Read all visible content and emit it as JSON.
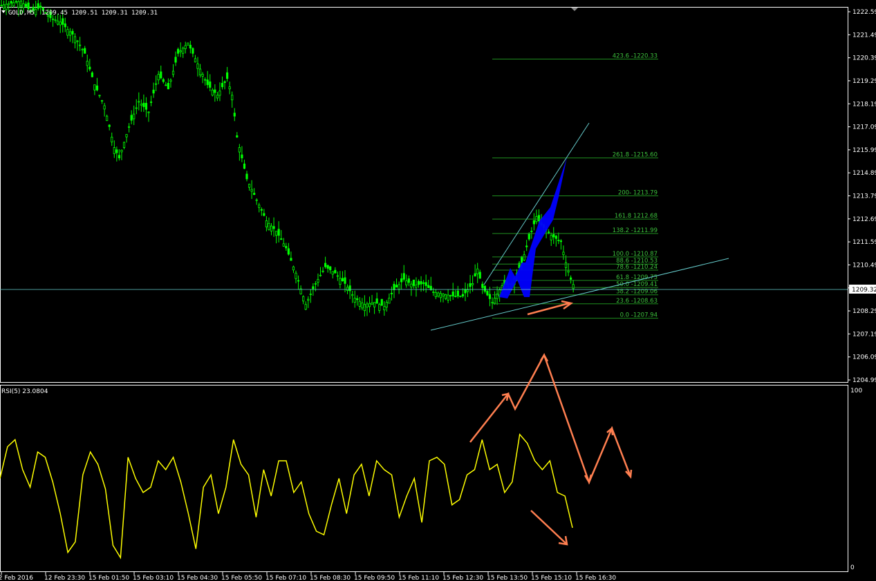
{
  "header": {
    "symbol_timeframe": "GOLD,M5",
    "ohlc": "1209.45 1209.51 1209.31 1209.31"
  },
  "price_axis": {
    "ticks": [
      "1222.59",
      "1221.49",
      "1220.39",
      "1219.29",
      "1218.19",
      "1217.09",
      "1215.99",
      "1214.89",
      "1213.79",
      "1212.69",
      "1211.59",
      "1210.49",
      "1209.39",
      "1208.29",
      "1207.19",
      "1206.09",
      "1204.99"
    ],
    "current_price_label": "1209.32"
  },
  "rsi": {
    "label": "RSI(5) 23.0804",
    "scale_max": "100",
    "scale_min": "0"
  },
  "time_axis": {
    "ticks": [
      "12 Feb 2016",
      "12 Feb 23:30",
      "15 Feb 01:50",
      "15 Feb 03:10",
      "15 Feb 04:30",
      "15 Feb 05:50",
      "15 Feb 07:10",
      "15 Feb 08:30",
      "15 Feb 09:50",
      "15 Feb 11:10",
      "15 Feb 12:30",
      "15 Feb 13:50",
      "15 Feb 15:10",
      "15 Feb 16:30"
    ]
  },
  "fibonacci": {
    "levels": [
      {
        "label": "423.6 -1220.33",
        "price": 1220.33
      },
      {
        "label": "261.8 -1215.60",
        "price": 1215.6
      },
      {
        "label": "200- 1213.79",
        "price": 1213.79
      },
      {
        "label": "161.8 1212.68",
        "price": 1212.68
      },
      {
        "label": "138.2 -1211.99",
        "price": 1211.99
      },
      {
        "label": "100.0 -1210.87",
        "price": 1210.87
      },
      {
        "label": "88.6 -1210.53",
        "price": 1210.53
      },
      {
        "label": "78.6 -1210.24",
        "price": 1210.24
      },
      {
        "label": "61.8 -1209.75",
        "price": 1209.75
      },
      {
        "label": "50.0 -1209.41",
        "price": 1209.41
      },
      {
        "label": "38.2 -1209.06",
        "price": 1209.06
      },
      {
        "label": "23.6 -1208.63",
        "price": 1208.63
      },
      {
        "label": "0.0 -1207.94",
        "price": 1207.94
      }
    ]
  },
  "colors": {
    "background": "#000000",
    "candle": "#00ff00",
    "fib_line": "#1f8f1f",
    "fib_text": "#3cc03c",
    "trendline": "#66cccc",
    "pattern_fill": "#0000ff",
    "rsi_line": "#ffff00",
    "annotation_arrow": "#ff7f50",
    "axis_text": "#ffffff"
  },
  "chart_data": [
    {
      "type": "candlestick",
      "title": "GOLD,M5",
      "ylim": [
        1204.99,
        1222.59
      ],
      "close_series": [
        [
          0,
          1222.9
        ],
        [
          4,
          1223.1
        ],
        [
          6,
          1222.6
        ],
        [
          8,
          1222.8
        ],
        [
          10,
          1222.3
        ],
        [
          12,
          1222.1
        ],
        [
          15,
          1221.4
        ],
        [
          17,
          1220.6
        ],
        [
          19,
          1219.1
        ],
        [
          21,
          1218.1
        ],
        [
          23,
          1216.1
        ],
        [
          24,
          1215.6
        ],
        [
          26,
          1217.1
        ],
        [
          28,
          1218.3
        ],
        [
          30,
          1217.8
        ],
        [
          32,
          1219.6
        ],
        [
          34,
          1218.9
        ],
        [
          36,
          1220.6
        ],
        [
          38,
          1221.1
        ],
        [
          40,
          1220.1
        ],
        [
          42,
          1219.1
        ],
        [
          44,
          1218.6
        ],
        [
          46,
          1219.4
        ],
        [
          47,
          1218.6
        ],
        [
          48,
          1216.6
        ],
        [
          50,
          1214.6
        ],
        [
          52,
          1213.6
        ],
        [
          54,
          1212.6
        ],
        [
          56,
          1212.1
        ],
        [
          58,
          1211.3
        ],
        [
          60,
          1210.1
        ],
        [
          62,
          1208.6
        ],
        [
          64,
          1209.6
        ],
        [
          66,
          1210.4
        ],
        [
          68,
          1210.1
        ],
        [
          70,
          1209.6
        ],
        [
          72,
          1208.9
        ],
        [
          74,
          1208.6
        ],
        [
          76,
          1208.7
        ],
        [
          78,
          1208.5
        ],
        [
          80,
          1209.3
        ],
        [
          82,
          1209.8
        ],
        [
          84,
          1209.5
        ],
        [
          86,
          1209.6
        ],
        [
          88,
          1209.2
        ],
        [
          90,
          1209.1
        ],
        [
          92,
          1209.0
        ],
        [
          94,
          1209.0
        ],
        [
          96,
          1209.6
        ],
        [
          97,
          1210.3
        ],
        [
          98,
          1209.4
        ],
        [
          100,
          1208.7
        ],
        [
          102,
          1209.5
        ],
        [
          104,
          1209.6
        ],
        [
          106,
          1210.6
        ],
        [
          108,
          1212.1
        ],
        [
          109,
          1212.8
        ],
        [
          110,
          1212.4
        ],
        [
          112,
          1211.9
        ],
        [
          114,
          1211.6
        ],
        [
          115,
          1210.6
        ],
        [
          116,
          1209.8
        ],
        [
          117,
          1209.31
        ]
      ],
      "xlabel": "",
      "ylabel": ""
    },
    {
      "type": "line",
      "title": "RSI(5) 23.0804",
      "ylim": [
        0,
        100
      ],
      "series": [
        {
          "values": [
            50,
            68,
            72,
            55,
            45,
            65,
            62,
            48,
            30,
            8,
            14,
            52,
            65,
            58,
            44,
            12,
            5,
            62,
            50,
            42,
            45,
            60,
            55,
            62,
            48,
            30,
            10,
            45,
            52,
            30,
            45,
            72,
            58,
            52,
            28,
            55,
            40,
            60,
            60,
            42,
            48,
            30,
            20,
            18,
            35,
            50,
            30,
            52,
            58,
            40,
            60,
            55,
            52,
            28,
            40,
            50,
            25,
            60,
            62,
            58,
            35,
            38,
            52,
            55,
            72,
            55,
            58,
            42,
            48,
            75,
            70,
            60,
            55,
            60,
            42,
            40,
            22
          ]
        }
      ]
    }
  ]
}
